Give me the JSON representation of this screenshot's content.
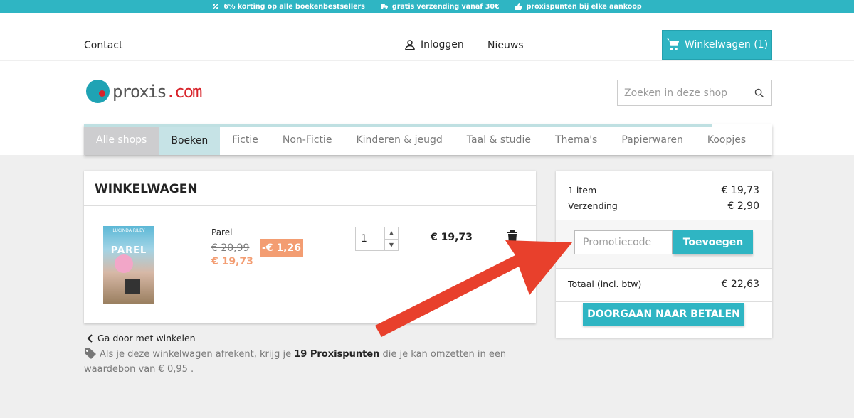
{
  "promo_bar": {
    "items": [
      {
        "icon": "percent-icon",
        "text": "6% korting op alle boekenbestsellers"
      },
      {
        "icon": "truck-icon",
        "text": "gratis verzending vanaf 30€"
      },
      {
        "icon": "thumbs-up-icon",
        "text": "proxispunten bij elke aankoop"
      }
    ]
  },
  "header": {
    "contact": "Contact",
    "login": "Inloggen",
    "news": "Nieuws",
    "cart_button": "Winkelwagen (1)",
    "logo_text_main": "proxis",
    "logo_text_suffix": ".com",
    "search_placeholder": "Zoeken in deze shop"
  },
  "nav": {
    "items": [
      "Alle shops",
      "Boeken",
      "Fictie",
      "Non-Fictie",
      "Kinderen & jeugd",
      "Taal & studie",
      "Thema's",
      "Papierwaren",
      "Koopjes"
    ],
    "active": "Boeken"
  },
  "cart": {
    "title": "WINKELWAGEN",
    "item": {
      "cover_author": "LUCINDA RILEY",
      "cover_title": "PAREL",
      "name": "Parel",
      "old_price": "€ 20,99",
      "new_price": "€ 19,73",
      "discount": "-€ 1,26",
      "quantity": "1",
      "line_total": "€ 19,73"
    },
    "continue_shopping": "Ga door met winkelen",
    "loyalty_prefix": "Als je deze winkelwagen afrekent, krijg je",
    "loyalty_points": "19 Proxispunten",
    "loyalty_suffix": "die je kan omzetten in een waardebon van € 0,95 ."
  },
  "summary": {
    "items_label": "1 item",
    "items_value": "€ 19,73",
    "shipping_label": "Verzending",
    "shipping_value": "€ 2,90",
    "promo_placeholder": "Promotiecode",
    "promo_button": "Toevoegen",
    "total_label": "Totaal (incl. btw)",
    "total_value": "€ 22,63",
    "checkout_button": "DOORGAAN NAAR BETALEN"
  },
  "colors": {
    "accent": "#2fb5c3",
    "discount": "#f39d72",
    "annotation_arrow": "#e8402c"
  }
}
